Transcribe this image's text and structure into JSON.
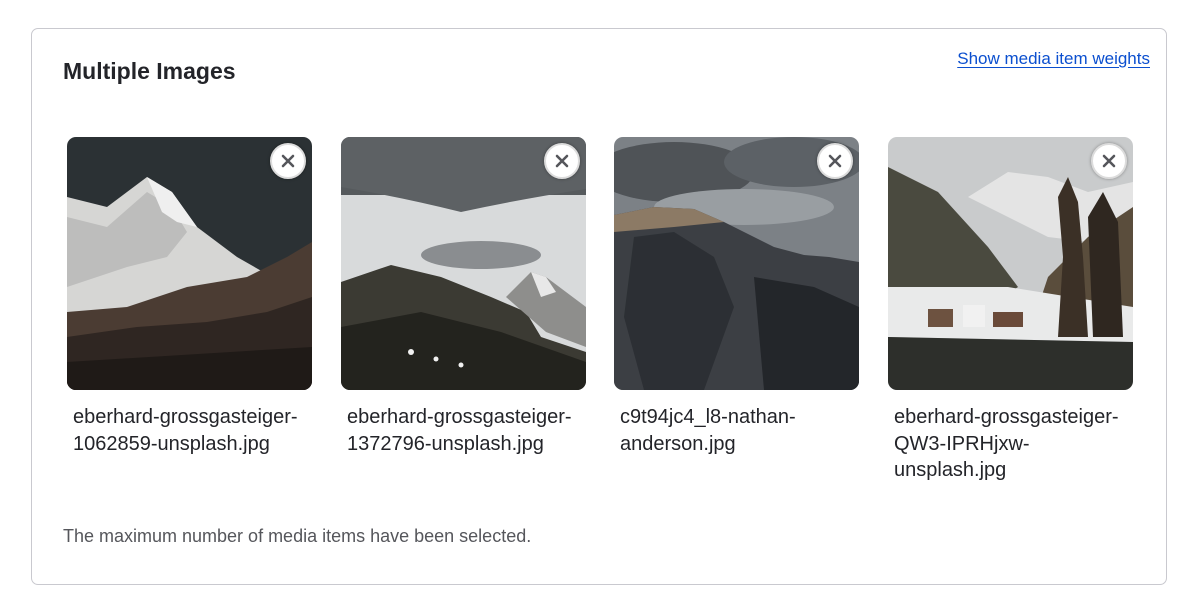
{
  "widget": {
    "title": "Multiple Images",
    "weights_link": "Show media item weights",
    "status_message": "The maximum number of media items have been selected."
  },
  "media_items": [
    {
      "filename": "eberhard-grossgasteiger-1062859-unsplash.jpg",
      "remove_icon": "close-icon"
    },
    {
      "filename": "eberhard-grossgasteiger-1372796-unsplash.jpg",
      "remove_icon": "close-icon"
    },
    {
      "filename": "c9t94jc4_l8-nathan-anderson.jpg",
      "remove_icon": "close-icon"
    },
    {
      "filename": "eberhard-grossgasteiger-QW3-IPRHjxw-unsplash.jpg",
      "remove_icon": "close-icon"
    }
  ]
}
